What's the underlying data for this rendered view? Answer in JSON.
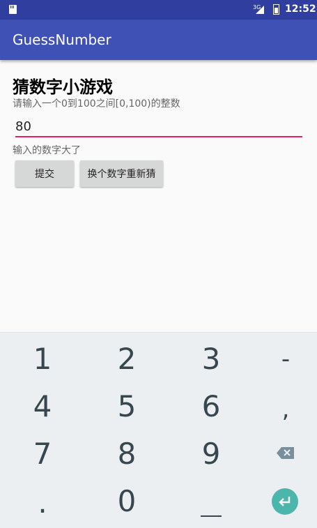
{
  "status_bar": {
    "network": "3G",
    "time": "12:52"
  },
  "app_bar": {
    "title": "GuessNumber"
  },
  "main": {
    "heading": "猜数字小游戏",
    "hint": "请输入一个0到100之间[0,100)的整数",
    "input_value": "80",
    "result_text": "输入的数字大了",
    "submit_label": "提交",
    "reset_label": "换个数字重新猜"
  },
  "keyboard": {
    "keys": [
      "1",
      "2",
      "3",
      "-",
      "4",
      "5",
      "6",
      ",",
      "7",
      "8",
      "9",
      ".",
      "0"
    ]
  },
  "colors": {
    "status_bar": "#303f9f",
    "app_bar": "#3f51b5",
    "accent": "#e91e63",
    "enter_key": "#4db6ac"
  }
}
